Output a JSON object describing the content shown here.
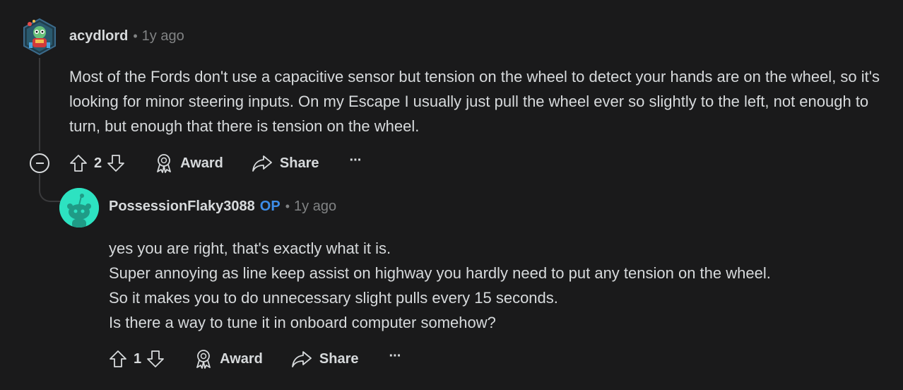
{
  "comment": {
    "username": "acydlord",
    "separator": "•",
    "time": "1y ago",
    "body": "Most of the Fords don't use a capacitive sensor but tension on the wheel to detect your hands are on the wheel, so it's looking for minor steering inputs. On my Escape I usually just pull the wheel ever so slightly to the left, not enough to turn, but enough that there is tension on the wheel.",
    "score": "2",
    "award_label": "Award",
    "share_label": "Share",
    "more_label": "···"
  },
  "reply": {
    "username": "PossessionFlaky3088",
    "op_badge": "OP",
    "separator": "•",
    "time": "1y ago",
    "lines": [
      "yes you are right, that's exactly what it is.",
      "Super annoying as line keep assist on highway you hardly need to put any tension on the wheel.",
      "So it makes you to do unnecessary slight pulls every 15 seconds.",
      "Is there a way to tune it in onboard computer somehow?"
    ],
    "score": "1",
    "award_label": "Award",
    "share_label": "Share",
    "more_label": "···"
  },
  "icons": {
    "upvote": "arrow-up-outline-icon",
    "downvote": "arrow-down-outline-icon",
    "award": "award-ribbon-icon",
    "share": "share-arrow-icon",
    "collapse": "minus-circle-icon"
  },
  "colors": {
    "background": "#1a1a1b",
    "text": "#d7dadc",
    "muted": "#818384",
    "op_badge": "#3d8de8",
    "reply_avatar": "#2de2c1",
    "thread_line": "#3a3a3c"
  }
}
